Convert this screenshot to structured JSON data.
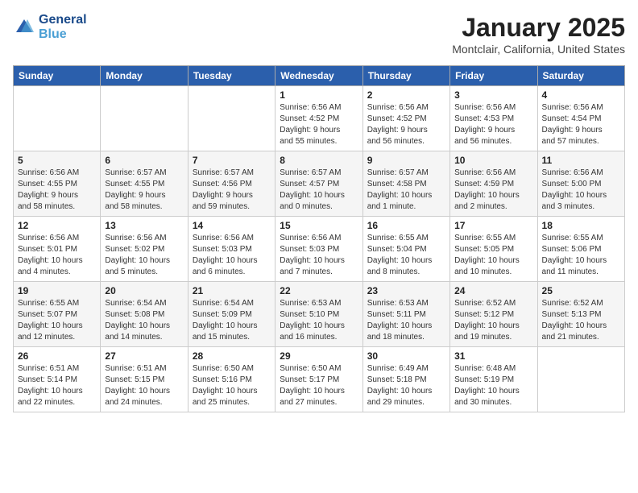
{
  "header": {
    "logo_line1": "General",
    "logo_line2": "Blue",
    "month": "January 2025",
    "location": "Montclair, California, United States"
  },
  "days_of_week": [
    "Sunday",
    "Monday",
    "Tuesday",
    "Wednesday",
    "Thursday",
    "Friday",
    "Saturday"
  ],
  "weeks": [
    [
      {
        "day": "",
        "info": ""
      },
      {
        "day": "",
        "info": ""
      },
      {
        "day": "",
        "info": ""
      },
      {
        "day": "1",
        "info": "Sunrise: 6:56 AM\nSunset: 4:52 PM\nDaylight: 9 hours\nand 55 minutes."
      },
      {
        "day": "2",
        "info": "Sunrise: 6:56 AM\nSunset: 4:52 PM\nDaylight: 9 hours\nand 56 minutes."
      },
      {
        "day": "3",
        "info": "Sunrise: 6:56 AM\nSunset: 4:53 PM\nDaylight: 9 hours\nand 56 minutes."
      },
      {
        "day": "4",
        "info": "Sunrise: 6:56 AM\nSunset: 4:54 PM\nDaylight: 9 hours\nand 57 minutes."
      }
    ],
    [
      {
        "day": "5",
        "info": "Sunrise: 6:56 AM\nSunset: 4:55 PM\nDaylight: 9 hours\nand 58 minutes."
      },
      {
        "day": "6",
        "info": "Sunrise: 6:57 AM\nSunset: 4:55 PM\nDaylight: 9 hours\nand 58 minutes."
      },
      {
        "day": "7",
        "info": "Sunrise: 6:57 AM\nSunset: 4:56 PM\nDaylight: 9 hours\nand 59 minutes."
      },
      {
        "day": "8",
        "info": "Sunrise: 6:57 AM\nSunset: 4:57 PM\nDaylight: 10 hours\nand 0 minutes."
      },
      {
        "day": "9",
        "info": "Sunrise: 6:57 AM\nSunset: 4:58 PM\nDaylight: 10 hours\nand 1 minute."
      },
      {
        "day": "10",
        "info": "Sunrise: 6:56 AM\nSunset: 4:59 PM\nDaylight: 10 hours\nand 2 minutes."
      },
      {
        "day": "11",
        "info": "Sunrise: 6:56 AM\nSunset: 5:00 PM\nDaylight: 10 hours\nand 3 minutes."
      }
    ],
    [
      {
        "day": "12",
        "info": "Sunrise: 6:56 AM\nSunset: 5:01 PM\nDaylight: 10 hours\nand 4 minutes."
      },
      {
        "day": "13",
        "info": "Sunrise: 6:56 AM\nSunset: 5:02 PM\nDaylight: 10 hours\nand 5 minutes."
      },
      {
        "day": "14",
        "info": "Sunrise: 6:56 AM\nSunset: 5:03 PM\nDaylight: 10 hours\nand 6 minutes."
      },
      {
        "day": "15",
        "info": "Sunrise: 6:56 AM\nSunset: 5:03 PM\nDaylight: 10 hours\nand 7 minutes."
      },
      {
        "day": "16",
        "info": "Sunrise: 6:55 AM\nSunset: 5:04 PM\nDaylight: 10 hours\nand 8 minutes."
      },
      {
        "day": "17",
        "info": "Sunrise: 6:55 AM\nSunset: 5:05 PM\nDaylight: 10 hours\nand 10 minutes."
      },
      {
        "day": "18",
        "info": "Sunrise: 6:55 AM\nSunset: 5:06 PM\nDaylight: 10 hours\nand 11 minutes."
      }
    ],
    [
      {
        "day": "19",
        "info": "Sunrise: 6:55 AM\nSunset: 5:07 PM\nDaylight: 10 hours\nand 12 minutes."
      },
      {
        "day": "20",
        "info": "Sunrise: 6:54 AM\nSunset: 5:08 PM\nDaylight: 10 hours\nand 14 minutes."
      },
      {
        "day": "21",
        "info": "Sunrise: 6:54 AM\nSunset: 5:09 PM\nDaylight: 10 hours\nand 15 minutes."
      },
      {
        "day": "22",
        "info": "Sunrise: 6:53 AM\nSunset: 5:10 PM\nDaylight: 10 hours\nand 16 minutes."
      },
      {
        "day": "23",
        "info": "Sunrise: 6:53 AM\nSunset: 5:11 PM\nDaylight: 10 hours\nand 18 minutes."
      },
      {
        "day": "24",
        "info": "Sunrise: 6:52 AM\nSunset: 5:12 PM\nDaylight: 10 hours\nand 19 minutes."
      },
      {
        "day": "25",
        "info": "Sunrise: 6:52 AM\nSunset: 5:13 PM\nDaylight: 10 hours\nand 21 minutes."
      }
    ],
    [
      {
        "day": "26",
        "info": "Sunrise: 6:51 AM\nSunset: 5:14 PM\nDaylight: 10 hours\nand 22 minutes."
      },
      {
        "day": "27",
        "info": "Sunrise: 6:51 AM\nSunset: 5:15 PM\nDaylight: 10 hours\nand 24 minutes."
      },
      {
        "day": "28",
        "info": "Sunrise: 6:50 AM\nSunset: 5:16 PM\nDaylight: 10 hours\nand 25 minutes."
      },
      {
        "day": "29",
        "info": "Sunrise: 6:50 AM\nSunset: 5:17 PM\nDaylight: 10 hours\nand 27 minutes."
      },
      {
        "day": "30",
        "info": "Sunrise: 6:49 AM\nSunset: 5:18 PM\nDaylight: 10 hours\nand 29 minutes."
      },
      {
        "day": "31",
        "info": "Sunrise: 6:48 AM\nSunset: 5:19 PM\nDaylight: 10 hours\nand 30 minutes."
      },
      {
        "day": "",
        "info": ""
      }
    ]
  ]
}
